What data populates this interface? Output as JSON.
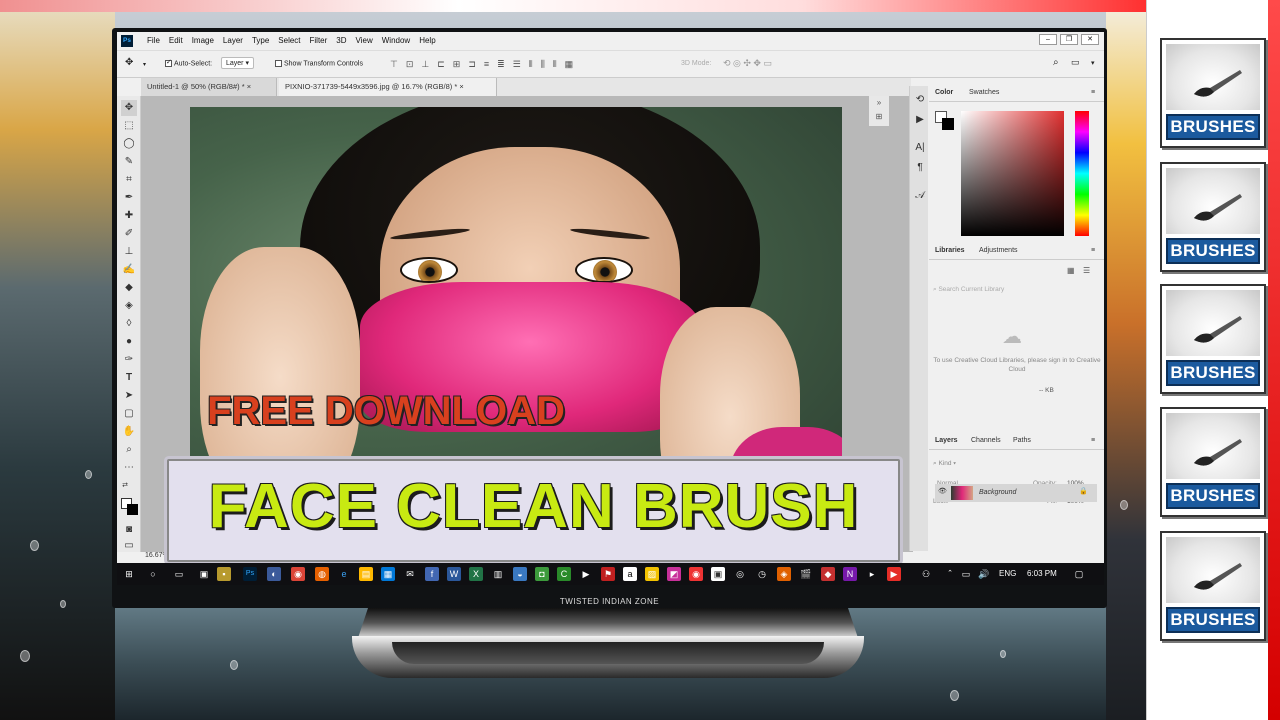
{
  "photoshop": {
    "logo": "Ps",
    "menu": [
      "File",
      "Edit",
      "Image",
      "Layer",
      "Type",
      "Select",
      "Filter",
      "3D",
      "View",
      "Window",
      "Help"
    ],
    "options": {
      "auto_select_label": "Auto-Select:",
      "auto_select_value": "Layer",
      "show_transform_label": "Show Transform Controls",
      "mode_3d_label": "3D Mode:"
    },
    "tabs": [
      {
        "label": "Untitled-1 @ 50% (RGB/8#) *"
      },
      {
        "label": "PIXNIO-371739-5449x3596.jpg @ 16.7% (RGB/8) *"
      }
    ],
    "zoom": "16.67%",
    "panels": {
      "color_tab": "Color",
      "swatches_tab": "Swatches",
      "libraries_tab": "Libraries",
      "adjustments_tab": "Adjustments",
      "search_placeholder": "Search Current Library",
      "library_message": "To use Creative Cloud Libraries, please sign in to Creative Cloud",
      "kb_label": "-- KB",
      "layers_tab": "Layers",
      "channels_tab": "Channels",
      "paths_tab": "Paths",
      "kind_label": "Kind",
      "blend_mode": "Normal",
      "opacity_label": "Opacity:",
      "opacity_value": "100%",
      "lock_label": "Lock:",
      "fill_label": "Fill:",
      "fill_value": "100%",
      "layer_name": "Background"
    }
  },
  "overlay": {
    "free_download": "FREE DOWNLOAD",
    "title": "FACE CLEAN BRUSH"
  },
  "taskbar": {
    "language": "ENG",
    "time": "6:03 PM"
  },
  "monitor": {
    "brand": "TWISTED INDIAN ZONE"
  },
  "sidebar": {
    "cards": [
      {
        "label": "BRUSHES"
      },
      {
        "label": "BRUSHES"
      },
      {
        "label": "BRUSHES"
      },
      {
        "label": "BRUSHES"
      },
      {
        "label": "BRUSHES"
      }
    ]
  },
  "colors": {
    "brush_label_bg": "#1b5a9e",
    "title_text": "#c8ea12",
    "free_download_text": "#d8401e"
  }
}
